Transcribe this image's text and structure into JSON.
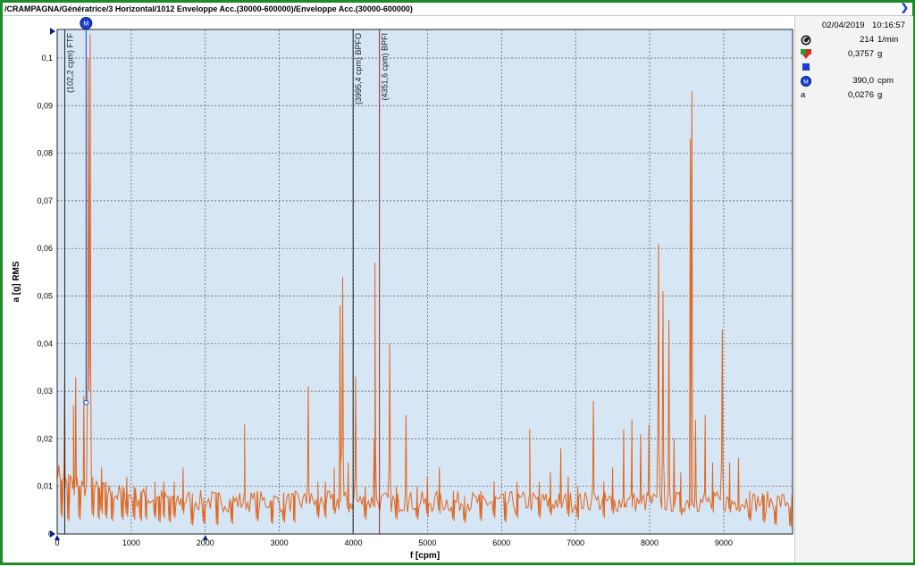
{
  "window": {
    "title": "/CRAMPAGNA/Génératrice/3 Horizontal/1012 Enveloppe Acc.(30000-600000)/Enveloppe Acc.(30000-600000)"
  },
  "side_panel": {
    "date": "02/04/2019",
    "time": "10:16:57",
    "rows": [
      {
        "icon": "speed-icon",
        "value": "214",
        "unit": "1/min"
      },
      {
        "icon": "level-icon",
        "value": "0,3757",
        "unit": "g"
      },
      {
        "icon": "square-marker-icon",
        "value": "",
        "unit": ""
      },
      {
        "icon": "marker-m-icon",
        "value": "390,0",
        "unit": "cpm"
      },
      {
        "icon": "a",
        "value": "0,0276",
        "unit": "g"
      }
    ]
  },
  "chart_data": {
    "type": "line",
    "xlabel": "f [cpm]",
    "ylabel": "a [g] RMS",
    "xlim": [
      0,
      9930
    ],
    "ylim": [
      0,
      0.106
    ],
    "x_ticks": [
      "0",
      "1000",
      "2000",
      "3000",
      "4000",
      "5000",
      "6000",
      "7000",
      "8000",
      "9000"
    ],
    "y_ticks": [
      "0",
      "0,01",
      "0,02",
      "0,03",
      "0,04",
      "0,05",
      "0,06",
      "0,07",
      "0,08",
      "0,09",
      "0,1"
    ],
    "grid": true,
    "series_color": "#e0671f",
    "markers": [
      {
        "x": 102.2,
        "label": "(102,2 cpm) FTF",
        "color": "#222222"
      },
      {
        "x": 3995.4,
        "label": "(3995,4 cpm) BPFO",
        "color": "#222222"
      },
      {
        "x": 4351.6,
        "label": "(4351,6 cpm) BPFI",
        "color": "#8a2a2a"
      }
    ],
    "cursor": {
      "x": 390,
      "y": 0.0276,
      "label": "M",
      "color": "#1a3fd0"
    },
    "peaks": [
      [
        60,
        0.0115
      ],
      [
        100,
        0.032
      ],
      [
        150,
        0.009
      ],
      [
        220,
        0.027
      ],
      [
        250,
        0.033
      ],
      [
        300,
        0.01
      ],
      [
        360,
        0.029
      ],
      [
        420,
        0.1
      ],
      [
        445,
        0.105
      ],
      [
        480,
        0.012
      ],
      [
        560,
        0.01
      ],
      [
        600,
        0.014
      ],
      [
        660,
        0.011
      ],
      [
        740,
        0.009
      ],
      [
        880,
        0.01
      ],
      [
        940,
        0.012
      ],
      [
        1040,
        0.01
      ],
      [
        1130,
        0.009
      ],
      [
        1200,
        0.01
      ],
      [
        1320,
        0.011
      ],
      [
        1380,
        0.008
      ],
      [
        1440,
        0.011
      ],
      [
        1520,
        0.008
      ],
      [
        1580,
        0.011
      ],
      [
        1700,
        0.014
      ],
      [
        1820,
        0.006
      ],
      [
        1980,
        0.007
      ],
      [
        2160,
        0.006
      ],
      [
        2360,
        0.007
      ],
      [
        2530,
        0.023
      ],
      [
        2700,
        0.009
      ],
      [
        2900,
        0.007
      ],
      [
        3060,
        0.008
      ],
      [
        3200,
        0.008
      ],
      [
        3390,
        0.031
      ],
      [
        3520,
        0.011
      ],
      [
        3620,
        0.011
      ],
      [
        3740,
        0.014
      ],
      [
        3820,
        0.048
      ],
      [
        3855,
        0.054
      ],
      [
        3930,
        0.015
      ],
      [
        4030,
        0.033
      ],
      [
        4160,
        0.01
      ],
      [
        4290,
        0.057
      ],
      [
        4490,
        0.04
      ],
      [
        4580,
        0.01
      ],
      [
        4710,
        0.025
      ],
      [
        4860,
        0.01
      ],
      [
        5000,
        0.012
      ],
      [
        5160,
        0.014
      ],
      [
        5350,
        0.009
      ],
      [
        5500,
        0.008
      ],
      [
        5720,
        0.009
      ],
      [
        5900,
        0.011
      ],
      [
        6050,
        0.008
      ],
      [
        6210,
        0.011
      ],
      [
        6380,
        0.022
      ],
      [
        6510,
        0.011
      ],
      [
        6660,
        0.013
      ],
      [
        6800,
        0.018
      ],
      [
        6900,
        0.012
      ],
      [
        7030,
        0.01
      ],
      [
        7240,
        0.028
      ],
      [
        7380,
        0.011
      ],
      [
        7500,
        0.014
      ],
      [
        7650,
        0.022
      ],
      [
        7760,
        0.024
      ],
      [
        7880,
        0.021
      ],
      [
        7990,
        0.023
      ],
      [
        8120,
        0.061
      ],
      [
        8180,
        0.051
      ],
      [
        8260,
        0.045
      ],
      [
        8330,
        0.02
      ],
      [
        8420,
        0.013
      ],
      [
        8550,
        0.083
      ],
      [
        8570,
        0.093
      ],
      [
        8620,
        0.024
      ],
      [
        8750,
        0.025
      ],
      [
        8850,
        0.015
      ],
      [
        8980,
        0.043
      ],
      [
        9080,
        0.015
      ],
      [
        9200,
        0.016
      ],
      [
        9350,
        0.009
      ],
      [
        9540,
        0.008
      ],
      [
        9700,
        0.006
      ],
      [
        9900,
        0.005
      ]
    ]
  }
}
